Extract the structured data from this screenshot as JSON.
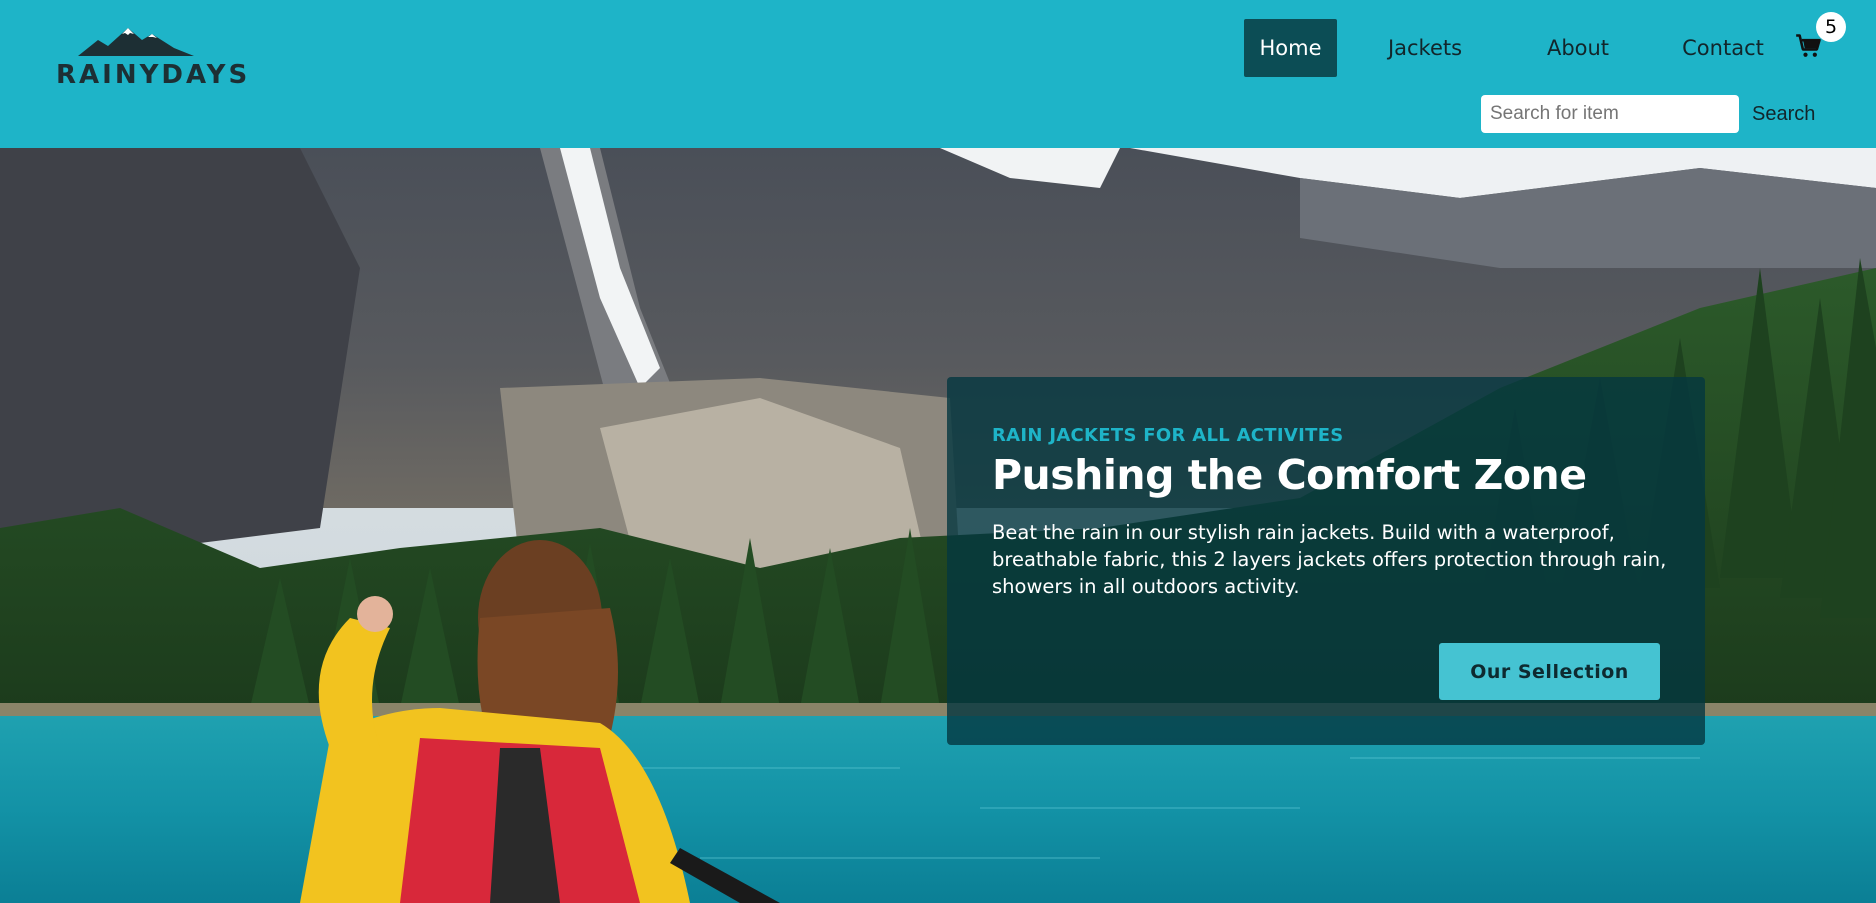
{
  "brand": {
    "name": "RAINYDAYS"
  },
  "nav": {
    "items": [
      {
        "label": "Home",
        "active": true
      },
      {
        "label": "Jackets",
        "active": false
      },
      {
        "label": "About",
        "active": false
      },
      {
        "label": "Contact",
        "active": false
      }
    ]
  },
  "cart": {
    "icon": "shopping-cart-icon",
    "count": "5"
  },
  "search": {
    "placeholder": "Search for item",
    "value": "",
    "button_label": "Search"
  },
  "hero": {
    "image": "woman-in-yellow-jacket-kayaking-on-mountain-lake",
    "eyebrow": "RAIN JACKETS FOR ALL ACTIVITES",
    "title": "Pushing the Comfort Zone",
    "text": "Beat the rain in our stylish rain jackets. Build with a waterproof, breathable fabric, this 2 layers jackets offers protection through rain, showers in all outdoors activity.",
    "cta_label": "Our Sellection"
  },
  "colors": {
    "header_bg": "#1eb4c8",
    "nav_active_bg": "#0c4d55",
    "card_bg": "#043740",
    "accent": "#1eb4c8",
    "cta_bg": "#45c3d2"
  }
}
